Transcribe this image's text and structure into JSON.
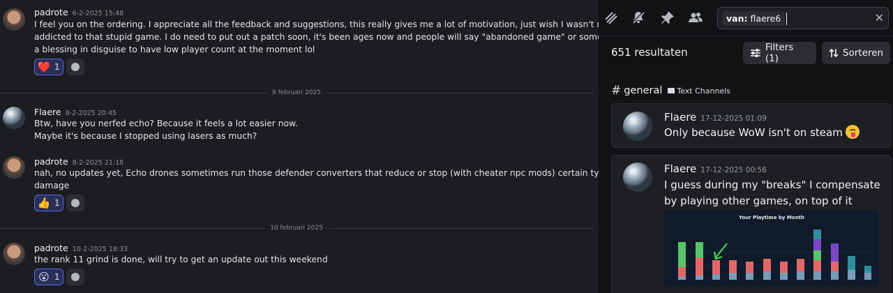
{
  "chat": {
    "messages": [
      {
        "author": "padrote",
        "timestamp": "6-2-2025 15:48",
        "lines": [
          "I feel you on the ordering.  I appreciate all the feedback and suggestions, this really gives me a lot of motivation, just wish I wasn't re-",
          "addicted to that stupid game. I do need to put out a patch soon, it's been ages now and people will say \"abandoned game\" or something. It's",
          "a blessing in disguise to have low player count at the moment lol"
        ],
        "reaction": {
          "emoji": "heart",
          "glyph": "❤️",
          "count": "1"
        }
      },
      {
        "author": "Flaere",
        "timestamp": "8-2-2025 20:45",
        "lines": [
          "Btw, have you nerfed echo? Because it feels a lot easier now.",
          "Maybe it's because I stopped using lasers as much?"
        ]
      },
      {
        "author": "padrote",
        "timestamp": "8-2-2025 21:18",
        "lines": [
          "nah, no updates yet, Echo drones sometimes run those defender converters that reduce or stop (with cheater npc mods) certain type of",
          "damage"
        ],
        "reaction": {
          "emoji": "thumbs-up",
          "glyph": "👍",
          "count": "1"
        }
      },
      {
        "author": "padrote",
        "timestamp": "10-2-2025 18:33",
        "lines": [
          "the rank 11 grind is done, will try to get an update out this weekend"
        ],
        "reaction": {
          "emoji": "surprised-face",
          "glyph": "😮",
          "count": "1"
        }
      }
    ],
    "dividers": [
      "8 februari 2025",
      "10 februari 2025"
    ]
  },
  "search": {
    "toolbar_icons": [
      "threads-icon",
      "mute-icon",
      "pin-icon",
      "members-icon"
    ],
    "filter_prefix": "van:",
    "filter_value": "flaere6",
    "results_count": "651 resultaten",
    "filters_label": "Filters (1)",
    "sort_label": "Sorteren",
    "channel_name": "general",
    "channel_category": "Text Channels",
    "results": [
      {
        "author": "Flaere",
        "timestamp": "17-12-2025 01:09",
        "text": "Only because WoW isn't on steam",
        "emoji": "tongue-face"
      },
      {
        "author": "Flaere",
        "timestamp": "17-12-2025 00:56",
        "lines": [
          "I guess during my \"breaks\"  I compensate",
          "by playing other games, on top of it"
        ],
        "attachment_title": "Your Playtime by Month"
      }
    ]
  },
  "colors": {
    "accent": "#5865f2",
    "background": "#1c1d21",
    "panel": "#111214",
    "bar_red": "#e2676a",
    "bar_green": "#57c46a",
    "bar_blue": "#7a9bb8",
    "bar_purple": "#7a45c7",
    "bar_teal": "#2f8fa0"
  }
}
